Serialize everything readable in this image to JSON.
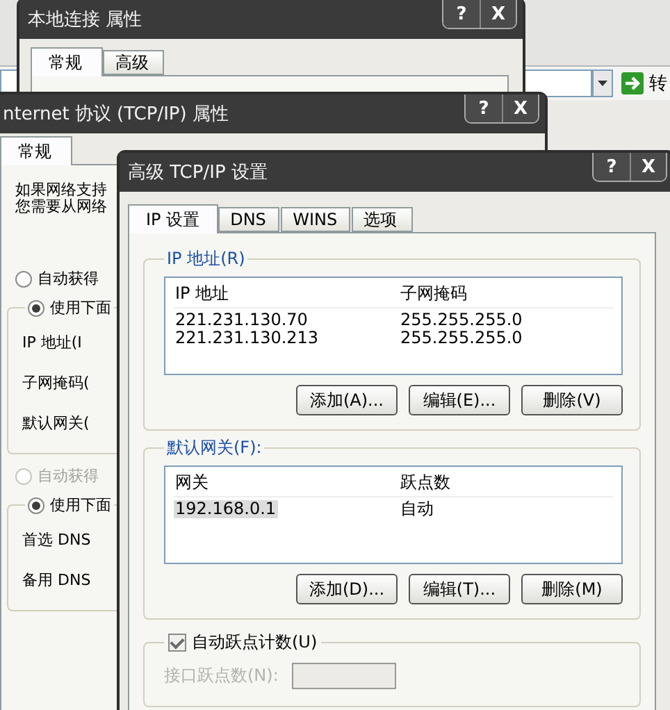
{
  "browser": {
    "go_label": "转"
  },
  "connection_dialog": {
    "title": "本地连接 属性",
    "help": "?",
    "close": "X",
    "tabs": [
      {
        "label": "常规",
        "selected": true
      },
      {
        "label": "高级",
        "selected": false
      }
    ]
  },
  "tcpip_dialog": {
    "title": "nternet 协议 (TCP/IP) 属性",
    "help": "?",
    "close": "X",
    "tabs": [
      {
        "label": "常规",
        "selected": true
      }
    ],
    "intro": [
      "如果网络支持",
      "您需要从网络"
    ],
    "sections": [
      {
        "auto": {
          "label": "自动获得",
          "selected": false,
          "disabled": false
        },
        "manual": {
          "label": "使用下面",
          "selected": true,
          "disabled": false
        },
        "fields": [
          "IP 地址(I",
          "子网掩码(",
          "默认网关("
        ]
      },
      {
        "auto": {
          "label": "自动获得",
          "selected": false,
          "disabled": true
        },
        "manual": {
          "label": "使用下面",
          "selected": true,
          "disabled": false
        },
        "fields": [
          "首选 DNS",
          "备用 DNS"
        ]
      }
    ]
  },
  "advanced_dialog": {
    "title": "高级 TCP/IP 设置",
    "help": "?",
    "close": "X",
    "tabs": [
      {
        "label": "IP 设置",
        "selected": true
      },
      {
        "label": "DNS",
        "selected": false
      },
      {
        "label": "WINS",
        "selected": false
      },
      {
        "label": "选项",
        "selected": false
      }
    ],
    "groups": [
      {
        "title": "IP 地址(R)",
        "columns": [
          "IP 地址",
          "子网掩码"
        ],
        "rows": [
          {
            "cells": [
              "221.231.130.70",
              "255.255.255.0"
            ],
            "selected": false
          },
          {
            "cells": [
              "221.231.130.213",
              "255.255.255.0"
            ],
            "selected": false
          }
        ],
        "buttons": [
          "添加(A)...",
          "编辑(E)...",
          "删除(V)"
        ]
      },
      {
        "title": "默认网关(F):",
        "columns": [
          "网关",
          "跃点数"
        ],
        "rows": [
          {
            "cells": [
              "192.168.0.1",
              "自动"
            ],
            "selected": true
          }
        ],
        "buttons": [
          "添加(D)...",
          "编辑(T)...",
          "删除(M)"
        ]
      }
    ],
    "metric": {
      "label": "自动跃点计数(U)",
      "checked": true,
      "field_label": "接口跃点数(N):",
      "field_disabled": true
    }
  }
}
